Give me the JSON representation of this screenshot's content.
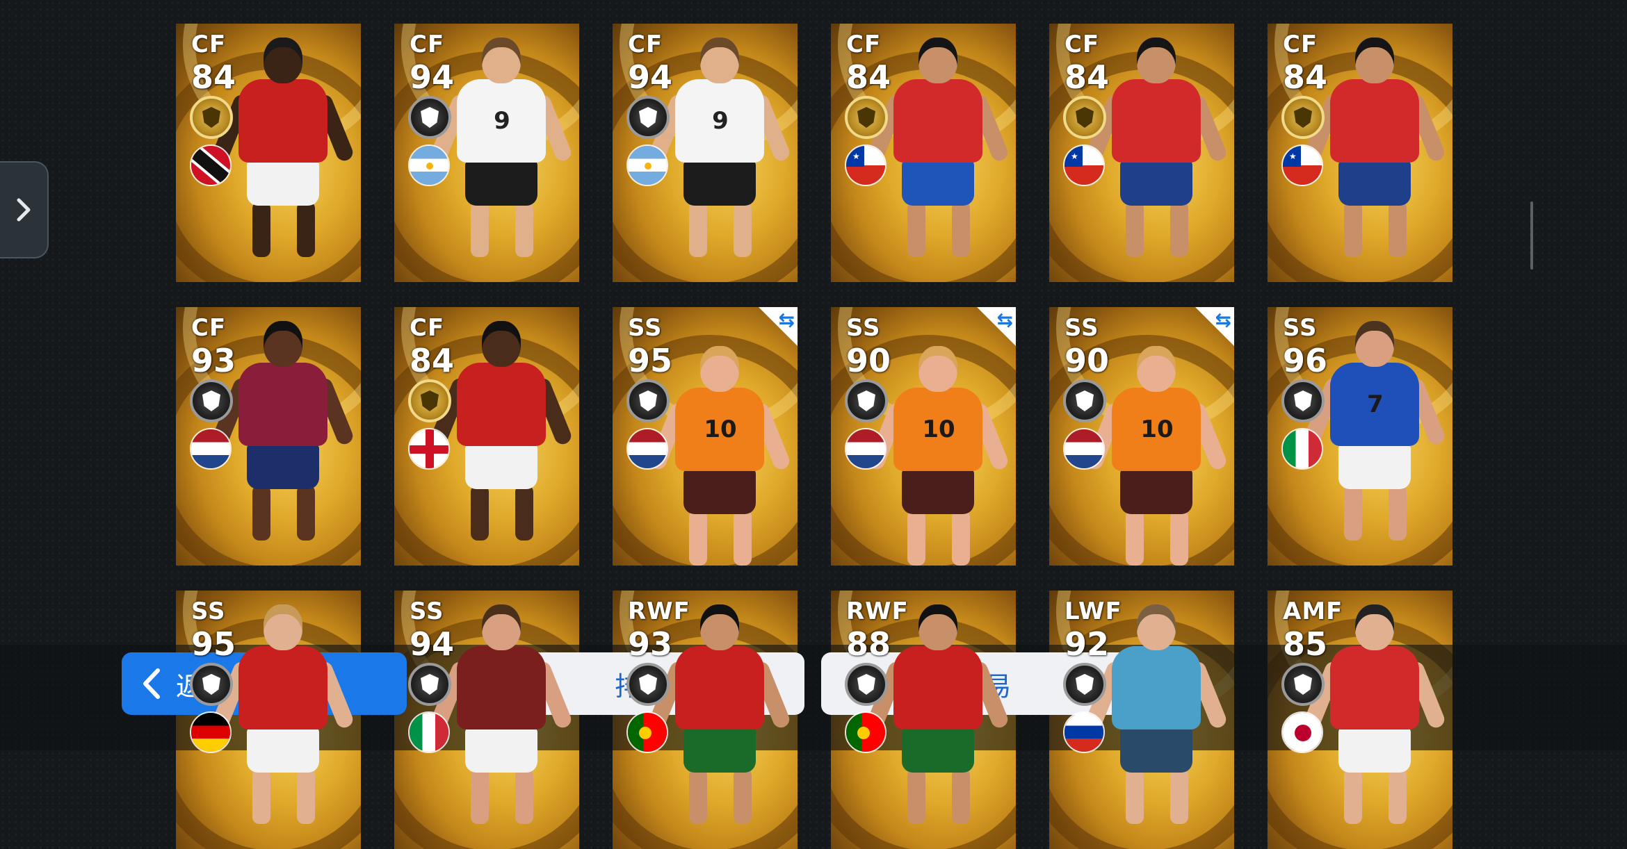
{
  "side_panel": {
    "icon": "chevron-right-icon"
  },
  "cards": [
    {
      "position": "CF",
      "rating": "84",
      "badge": "gold",
      "flag": "trinidad",
      "swap": false,
      "shirt": "#c8201e",
      "shorts": "#f2f2f2",
      "skin": "#3a2416",
      "hair": "#1a1a1a",
      "num": ""
    },
    {
      "position": "CF",
      "rating": "94",
      "badge": "black",
      "flag": "argentina",
      "swap": false,
      "shirt": "#f4f4f4",
      "shorts": "#1c1c1c",
      "skin": "#e0b08a",
      "hair": "#6b4a2a",
      "num": "9"
    },
    {
      "position": "CF",
      "rating": "94",
      "badge": "black",
      "flag": "argentina",
      "swap": false,
      "shirt": "#f4f4f4",
      "shorts": "#1c1c1c",
      "skin": "#e0b08a",
      "hair": "#6b4a2a",
      "num": "9"
    },
    {
      "position": "CF",
      "rating": "84",
      "badge": "gold",
      "flag": "chile",
      "swap": false,
      "shirt": "#d22a2a",
      "shorts": "#1f55b8",
      "skin": "#c89068",
      "hair": "#151515",
      "num": ""
    },
    {
      "position": "CF",
      "rating": "84",
      "badge": "gold",
      "flag": "chile",
      "swap": false,
      "shirt": "#d22a2a",
      "shorts": "#1f3f8a",
      "skin": "#c89068",
      "hair": "#151515",
      "num": ""
    },
    {
      "position": "CF",
      "rating": "84",
      "badge": "gold",
      "flag": "chile",
      "swap": false,
      "shirt": "#d22a2a",
      "shorts": "#1f3f8a",
      "skin": "#c89068",
      "hair": "#151515",
      "num": ""
    },
    {
      "position": "CF",
      "rating": "93",
      "badge": "black",
      "flag": "netherlands",
      "swap": false,
      "shirt": "#8a1e3a",
      "shorts": "#1d2f6a",
      "skin": "#5a3420",
      "hair": "#111111",
      "num": ""
    },
    {
      "position": "CF",
      "rating": "84",
      "badge": "gold",
      "flag": "england",
      "swap": false,
      "shirt": "#c8201e",
      "shorts": "#f2f2f2",
      "skin": "#4a2c1a",
      "hair": "#111111",
      "num": ""
    },
    {
      "position": "SS",
      "rating": "95",
      "badge": "black",
      "flag": "netherlands",
      "swap": true,
      "shirt": "#f07f1a",
      "shorts": "#4a1e1a",
      "skin": "#e8b090",
      "hair": "#d9a55a",
      "num": "10"
    },
    {
      "position": "SS",
      "rating": "90",
      "badge": "black",
      "flag": "netherlands",
      "swap": true,
      "shirt": "#f07f1a",
      "shorts": "#4a1e1a",
      "skin": "#e8b090",
      "hair": "#d9a55a",
      "num": "10"
    },
    {
      "position": "SS",
      "rating": "90",
      "badge": "black",
      "flag": "netherlands",
      "swap": true,
      "shirt": "#f07f1a",
      "shorts": "#4a1e1a",
      "skin": "#e8b090",
      "hair": "#d9a55a",
      "num": "10"
    },
    {
      "position": "SS",
      "rating": "96",
      "badge": "black",
      "flag": "italy",
      "swap": false,
      "shirt": "#1f4fb8",
      "shorts": "#f2f2f2",
      "skin": "#d8a080",
      "hair": "#4a3420",
      "num": "7"
    },
    {
      "position": "SS",
      "rating": "95",
      "badge": "black",
      "flag": "germany",
      "swap": false,
      "shirt": "#c8201e",
      "shorts": "#f2f2f2",
      "skin": "#e0b090",
      "hair": "#c89a5a",
      "num": ""
    },
    {
      "position": "SS",
      "rating": "94",
      "badge": "black",
      "flag": "italy",
      "swap": false,
      "shirt": "#7a1e1e",
      "shorts": "#f2f2f2",
      "skin": "#d8a080",
      "hair": "#4a3018",
      "num": ""
    },
    {
      "position": "RWF",
      "rating": "93",
      "badge": "black",
      "flag": "portugal",
      "swap": false,
      "shirt": "#c8201e",
      "shorts": "#1a6a2a",
      "skin": "#c89068",
      "hair": "#111111",
      "num": ""
    },
    {
      "position": "RWF",
      "rating": "88",
      "badge": "black",
      "flag": "portugal",
      "swap": false,
      "shirt": "#c8201e",
      "shorts": "#1a6a2a",
      "skin": "#c89068",
      "hair": "#111111",
      "num": ""
    },
    {
      "position": "LWF",
      "rating": "92",
      "badge": "black",
      "flag": "russia",
      "swap": false,
      "shirt": "#4aa0c8",
      "shorts": "#2a4a6a",
      "skin": "#e0b090",
      "hair": "#7a6040",
      "num": ""
    },
    {
      "position": "AMF",
      "rating": "85",
      "badge": "black",
      "flag": "japan",
      "swap": false,
      "shirt": "#d22a2a",
      "shorts": "#f2f2f2",
      "skin": "#e0b090",
      "hair": "#222222",
      "num": ""
    }
  ],
  "buttons": {
    "back_label": "返回",
    "back_icon": "chevron-left-icon",
    "sort_label": "排序",
    "trade_label": "交易"
  }
}
